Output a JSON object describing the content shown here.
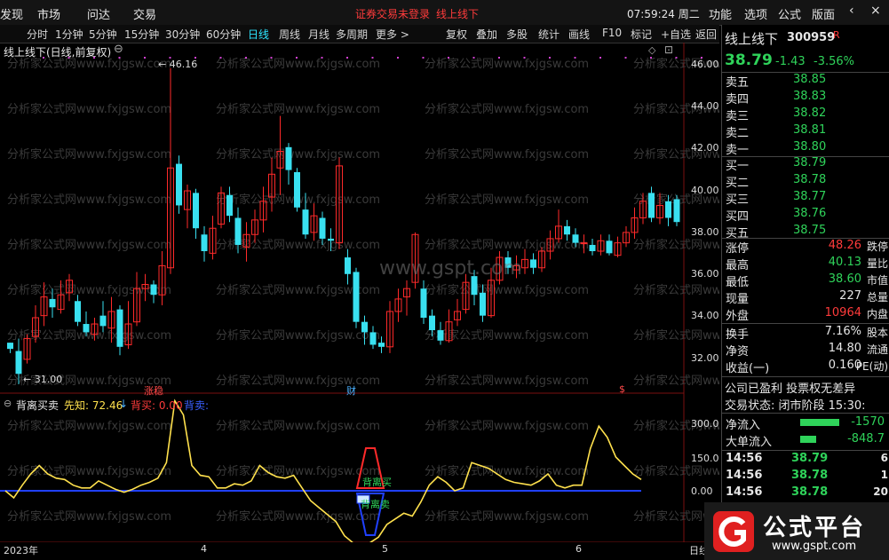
{
  "topbar": {
    "items": [
      "发现",
      "市场",
      "问达",
      "交易"
    ],
    "alert": "证券交易未登录",
    "alert_stock": "线上线下",
    "clock": "07:59:24 周二",
    "right_items": [
      "功能",
      "选项",
      "公式",
      "版面"
    ]
  },
  "periodbar": {
    "periods": [
      "分时",
      "1分钟",
      "5分钟",
      "15分钟",
      "30分钟",
      "60分钟",
      "日线",
      "周线",
      "月线",
      "多周期",
      "更多 >"
    ],
    "active": "日线",
    "tools": [
      "复权",
      "叠加",
      "多股",
      "统计",
      "画线",
      "F10",
      "标记",
      "+自选",
      "返回"
    ]
  },
  "chart": {
    "title": "线上线下(日线,前复权)",
    "high_label": "46.16",
    "low_label": "31.00",
    "yticks": [
      "46.00",
      "44.00",
      "42.00",
      "40.00",
      "38.00",
      "36.00",
      "34.00",
      "32.00"
    ],
    "markers": [
      "涨稳",
      "财",
      "$"
    ],
    "watermark": "www.gspt.com",
    "watermark_small": "分析家公式网www.fxjgsw.com"
  },
  "indicator": {
    "name": "背离买卖",
    "xianzhi_label": "先知: 72.46",
    "beimai_label": "背买: 0.00",
    "beimai2_label": "背卖:",
    "yticks": [
      "300.0",
      "150.0",
      "0.00"
    ],
    "buy_label": "背离买",
    "sell_label": "背离卖"
  },
  "xaxis": [
    "2023年",
    "4",
    "5",
    "6",
    "日线"
  ],
  "quote": {
    "name": "线上线下",
    "code": "300959",
    "tag": "R",
    "price": "38.79",
    "change": "-1.43",
    "change_pct": "-3.56%",
    "asks": [
      {
        "label": "卖五",
        "price": "38.85"
      },
      {
        "label": "卖四",
        "price": "38.83"
      },
      {
        "label": "卖三",
        "price": "38.82"
      },
      {
        "label": "卖二",
        "price": "38.81"
      },
      {
        "label": "卖一",
        "price": "38.80"
      }
    ],
    "bids": [
      {
        "label": "买一",
        "price": "38.79"
      },
      {
        "label": "买二",
        "price": "38.78"
      },
      {
        "label": "买三",
        "price": "38.77"
      },
      {
        "label": "买四",
        "price": "38.76"
      },
      {
        "label": "买五",
        "price": "38.75"
      }
    ],
    "stats": [
      {
        "k": "涨停",
        "v": "48.26",
        "c": "red",
        "k2": "跌停"
      },
      {
        "k": "最高",
        "v": "40.13",
        "c": "green",
        "k2": "量比"
      },
      {
        "k": "最低",
        "v": "38.60",
        "c": "green",
        "k2": "市值"
      },
      {
        "k": "现量",
        "v": "227",
        "c": "white",
        "k2": "总量"
      },
      {
        "k": "外盘",
        "v": "10964",
        "c": "red",
        "k2": "内盘"
      }
    ],
    "stats2": [
      {
        "k": "换手",
        "v": "7.16%",
        "k2": "股本"
      },
      {
        "k": "净资",
        "v": "14.80",
        "k2": "流通"
      },
      {
        "k": "收益(一)",
        "v": "0.160",
        "k2": "PE(动)"
      }
    ],
    "notice1": "公司已盈利 投票权无差异",
    "notice2": "交易状态: 闭市阶段 15:30:",
    "flows": [
      {
        "k": "净流入",
        "v": "-1570"
      },
      {
        "k": "大单流入",
        "v": "-848.7"
      }
    ],
    "ticks": [
      {
        "t": "14:56",
        "p": "38.79",
        "v": "6"
      },
      {
        "t": "14:56",
        "p": "38.78",
        "v": "1"
      },
      {
        "t": "14:56",
        "p": "38.78",
        "v": "20"
      },
      {
        "t": "14:56",
        "p": "38.78",
        "v": ""
      }
    ]
  },
  "logo": {
    "name": "公式平台",
    "url": "www.gspt.com"
  },
  "chart_data": {
    "type": "candlestick",
    "ylim": [
      31,
      47
    ],
    "candles": [
      [
        33.0,
        32.7,
        33.0,
        32.5
      ],
      [
        32.6,
        31.5,
        33.2,
        31.0
      ],
      [
        32.2,
        33.2,
        33.4,
        32.0
      ],
      [
        33.3,
        34.2,
        34.8,
        33.0
      ],
      [
        34.3,
        35.2,
        35.9,
        33.8
      ],
      [
        35.1,
        34.7,
        35.6,
        34.2
      ],
      [
        34.6,
        35.3,
        36.0,
        34.4
      ],
      [
        35.4,
        36.0,
        36.3,
        35.0
      ],
      [
        35.0,
        34.0,
        35.3,
        33.8
      ],
      [
        33.9,
        33.5,
        34.5,
        33.3
      ],
      [
        33.4,
        33.9,
        34.2,
        33.1
      ],
      [
        34.3,
        33.8,
        35.0,
        33.5
      ],
      [
        33.7,
        34.5,
        35.2,
        33.0
      ],
      [
        34.6,
        32.8,
        34.8,
        32.4
      ],
      [
        32.9,
        33.9,
        35.0,
        32.7
      ],
      [
        34.0,
        35.6,
        36.4,
        33.8
      ],
      [
        35.6,
        35.8,
        36.3,
        35.0
      ],
      [
        35.8,
        35.3,
        36.0,
        34.9
      ],
      [
        35.3,
        36.7,
        37.4,
        34.8
      ],
      [
        36.6,
        41.4,
        46.2,
        36.3
      ],
      [
        41.6,
        39.6,
        42.0,
        39.2
      ],
      [
        39.4,
        40.3,
        40.6,
        38.5
      ],
      [
        40.2,
        38.5,
        40.4,
        38.0
      ],
      [
        38.2,
        37.4,
        38.6,
        36.9
      ],
      [
        37.3,
        38.5,
        39.1,
        37.0
      ],
      [
        38.7,
        40.2,
        40.5,
        38.5
      ],
      [
        40.1,
        39.1,
        40.5,
        38.8
      ],
      [
        39.0,
        37.7,
        39.5,
        37.3
      ],
      [
        37.6,
        38.2,
        38.8,
        36.9
      ],
      [
        38.2,
        38.9,
        39.4,
        37.8
      ],
      [
        38.9,
        39.8,
        40.5,
        38.3
      ],
      [
        40.0,
        41.1,
        41.9,
        39.3
      ],
      [
        41.4,
        42.2,
        43.9,
        40.1
      ],
      [
        42.4,
        41.3,
        42.6,
        40.6
      ],
      [
        41.2,
        39.5,
        41.4,
        39.3
      ],
      [
        39.4,
        38.2,
        40.2,
        38.0
      ],
      [
        38.3,
        39.1,
        39.7,
        37.9
      ],
      [
        39.0,
        38.0,
        39.3,
        37.7
      ],
      [
        38.0,
        37.9,
        38.5,
        37.4
      ],
      [
        37.8,
        41.5,
        41.9,
        37.5
      ],
      [
        37.1,
        36.3,
        37.5,
        35.8
      ],
      [
        36.4,
        34.0,
        36.6,
        33.7
      ],
      [
        34.0,
        33.5,
        34.3,
        32.9
      ],
      [
        33.5,
        32.9,
        33.8,
        32.7
      ],
      [
        33.0,
        32.8,
        33.3,
        32.5
      ],
      [
        32.8,
        34.5,
        35.0,
        32.5
      ],
      [
        34.5,
        35.1,
        35.6,
        34.0
      ],
      [
        35.2,
        35.6,
        36.0,
        34.3
      ],
      [
        35.9,
        38.2,
        38.3,
        35.6
      ],
      [
        35.6,
        34.2,
        36.0,
        33.9
      ],
      [
        34.3,
        33.6,
        34.6,
        33.3
      ],
      [
        33.6,
        33.1,
        34.0,
        32.9
      ],
      [
        33.1,
        34.0,
        34.6,
        33.0
      ],
      [
        34.1,
        34.5,
        35.1,
        33.8
      ],
      [
        34.6,
        35.9,
        36.3,
        34.4
      ],
      [
        36.2,
        35.3,
        36.5,
        34.8
      ],
      [
        35.4,
        34.3,
        35.8,
        34.0
      ],
      [
        34.3,
        36.0,
        36.6,
        34.2
      ],
      [
        36.0,
        37.1,
        37.4,
        35.8
      ],
      [
        37.1,
        36.6,
        37.4,
        36.3
      ],
      [
        36.5,
        36.7,
        37.2,
        36.1
      ],
      [
        36.6,
        37.0,
        37.5,
        36.3
      ],
      [
        37.0,
        36.6,
        37.3,
        36.3
      ],
      [
        36.6,
        37.4,
        37.6,
        36.4
      ],
      [
        37.4,
        38.0,
        38.4,
        37.0
      ],
      [
        38.0,
        38.6,
        39.4,
        37.8
      ],
      [
        38.6,
        38.2,
        38.9,
        37.9
      ],
      [
        38.2,
        37.8,
        38.5,
        37.6
      ],
      [
        37.8,
        37.8,
        38.2,
        37.3
      ],
      [
        37.7,
        37.4,
        38.0,
        37.2
      ],
      [
        37.4,
        37.9,
        38.2,
        37.2
      ],
      [
        37.9,
        37.3,
        38.2,
        37.2
      ],
      [
        37.2,
        37.8,
        38.1,
        37.1
      ],
      [
        37.8,
        38.3,
        38.6,
        37.6
      ],
      [
        38.3,
        39.0,
        39.5,
        38.0
      ],
      [
        39.0,
        39.8,
        40.2,
        38.7
      ],
      [
        40.2,
        39.0,
        40.5,
        38.8
      ],
      [
        39.0,
        39.6,
        40.2,
        38.7
      ],
      [
        39.8,
        39.0,
        40.1,
        38.6
      ],
      [
        39.9,
        38.8,
        40.1,
        38.6
      ]
    ],
    "indicator_series": [
      0,
      -25,
      20,
      60,
      90,
      60,
      45,
      40,
      20,
      10,
      10,
      35,
      20,
      5,
      -5,
      5,
      20,
      30,
      45,
      100,
      320,
      270,
      90,
      55,
      50,
      10,
      10,
      25,
      20,
      35,
      90,
      65,
      50,
      45,
      55,
      10,
      -35,
      -60,
      -85,
      -110,
      -160,
      -185,
      -200,
      -185,
      -165,
      -120,
      -100,
      -80,
      -90,
      -40,
      20,
      50,
      30,
      0,
      10,
      100,
      90,
      80,
      60,
      40,
      30,
      25,
      20,
      35,
      60,
      20,
      10,
      20,
      20,
      150,
      230,
      190,
      120,
      90,
      60,
      40
    ]
  }
}
